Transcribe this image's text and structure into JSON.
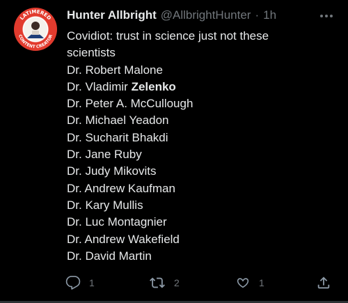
{
  "tweet": {
    "author_name": "Hunter Allbright",
    "author_handle": "@AllbrightHunter",
    "separator": "·",
    "time": "1h",
    "avatar_text_top": "LATIMERED",
    "avatar_text_bottom": "CONTENT CREATOR",
    "intro": "Covidiot: trust in science just not these scientists",
    "lines": [
      "Dr. Robert Malone",
      "Dr. Vladimir ",
      "Dr. Peter A. McCullough",
      "Dr. Michael Yeadon",
      "Dr. Sucharit Bhakdi",
      "Dr. Jane Ruby",
      "Dr. Judy Mikovits",
      "Dr. Andrew Kaufman",
      "Dr. Kary Mullis",
      "Dr. Luc Montagnier",
      "Dr. Andrew Wakefield",
      "Dr. David Martin"
    ],
    "line2_bold": "Zelenko"
  },
  "actions": {
    "reply_icon": "reply-icon",
    "reply_count": "1",
    "retweet_icon": "retweet-icon",
    "retweet_count": "2",
    "like_icon": "heart-icon",
    "like_count": "1",
    "share_icon": "share-icon"
  },
  "colors": {
    "background": "#000000",
    "text": "#e7e9ea",
    "muted": "#71767b",
    "avatar_ring": "#e23b2e"
  }
}
